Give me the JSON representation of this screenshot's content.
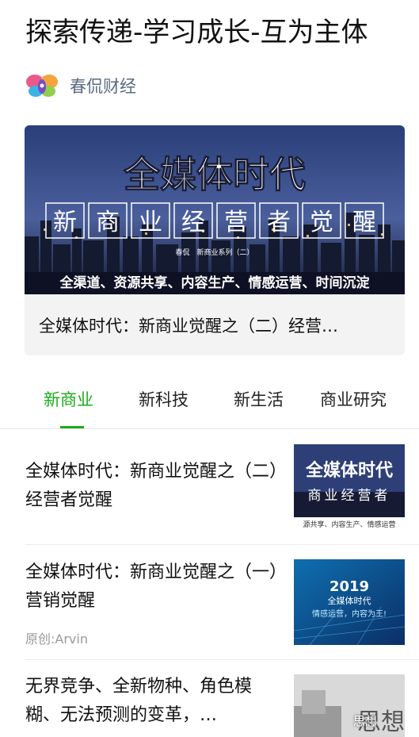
{
  "page": {
    "title": "探索传递-学习成长-互为主体"
  },
  "account": {
    "name": "春侃财经",
    "icon": "butterfly-logo"
  },
  "banner": {
    "image_title": "全媒体时代",
    "image_subtitle_chars": [
      "新",
      "商",
      "业",
      "经",
      "营",
      "者",
      "觉",
      "醒"
    ],
    "image_small_text": "春侃　新商业系列（二）",
    "image_tagline": "全渠道、资源共享、内容生产、情感运营、时间沉淀",
    "caption": "全媒体时代：新商业觉醒之（二）经营…"
  },
  "tabs": [
    {
      "label": "新商业",
      "active": true
    },
    {
      "label": "新科技",
      "active": false
    },
    {
      "label": "新生活",
      "active": false
    },
    {
      "label": "商业研究",
      "active": false
    }
  ],
  "articles": [
    {
      "headline": "全媒体时代：新商业觉醒之（二）经营者觉醒",
      "meta": "",
      "thumb_text_1": "全媒体时代",
      "thumb_text_2": "商业经营者",
      "thumb_text_3": "源共享、内容生产、情感运营"
    },
    {
      "headline": "全媒体时代：新商业觉醒之（一）营销觉醒",
      "meta": "原创:Arvin",
      "thumb_text_1": "2019",
      "thumb_text_2": "全媒体时代",
      "thumb_text_3": "情感运营，内容为王!"
    },
    {
      "headline": "无界竞争、全新物种、角色模糊、无法预测的变革，…",
      "meta": "",
      "thumb_text_1": "思想"
    }
  ],
  "watermark": "思想",
  "colors": {
    "accent_green": "#1aad19",
    "account_text": "#5b6b80"
  }
}
